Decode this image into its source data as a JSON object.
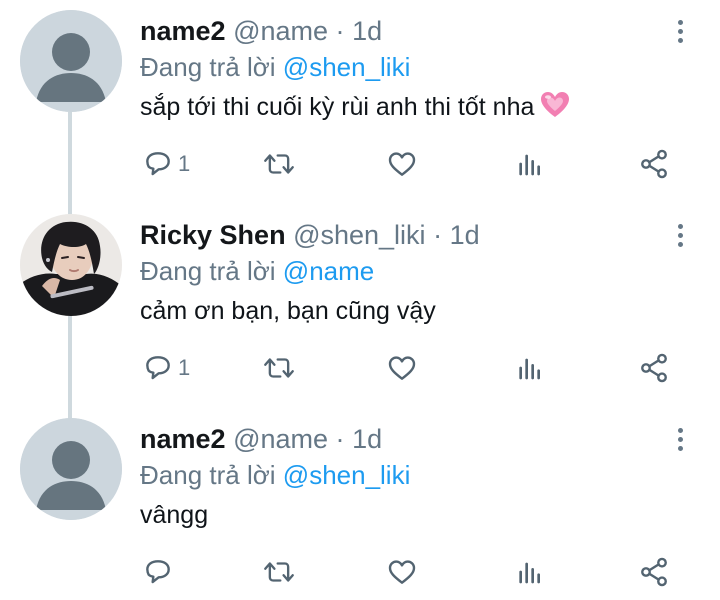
{
  "tweets": [
    {
      "display_name": "name2",
      "handle": "@name",
      "dot": "·",
      "time": "1d",
      "replying_to_label": "Đang trả lời",
      "replying_to_handle": "@shen_liki",
      "text": "sắp tới thi cuối kỳ rùi anh thi tốt nha",
      "reply_count": "1",
      "avatar": "default-avatar-icon"
    },
    {
      "display_name": "Ricky Shen",
      "handle": "@shen_liki",
      "dot": "·",
      "time": "1d",
      "replying_to_label": "Đang trả lời",
      "replying_to_handle": "@name",
      "text": "cảm ơn bạn, bạn cũng vậy",
      "reply_count": "1",
      "avatar": "profile-photo"
    },
    {
      "display_name": "name2",
      "handle": "@name",
      "dot": "·",
      "time": "1d",
      "replying_to_label": "Đang trả lời",
      "replying_to_handle": "@shen_liki",
      "text": "vângg",
      "reply_count": "",
      "avatar": "default-avatar-icon"
    }
  ],
  "colors": {
    "mention": "#1d9bf0",
    "muted": "#657786",
    "thread_line": "#cfd9de",
    "avatar_bg": "#ccd6dd",
    "avatar_silhouette": "#66757f"
  },
  "icons": [
    "reply-icon",
    "retweet-icon",
    "like-icon",
    "views-icon",
    "share-icon",
    "more-options-icon",
    "pink-heart-emoji"
  ]
}
